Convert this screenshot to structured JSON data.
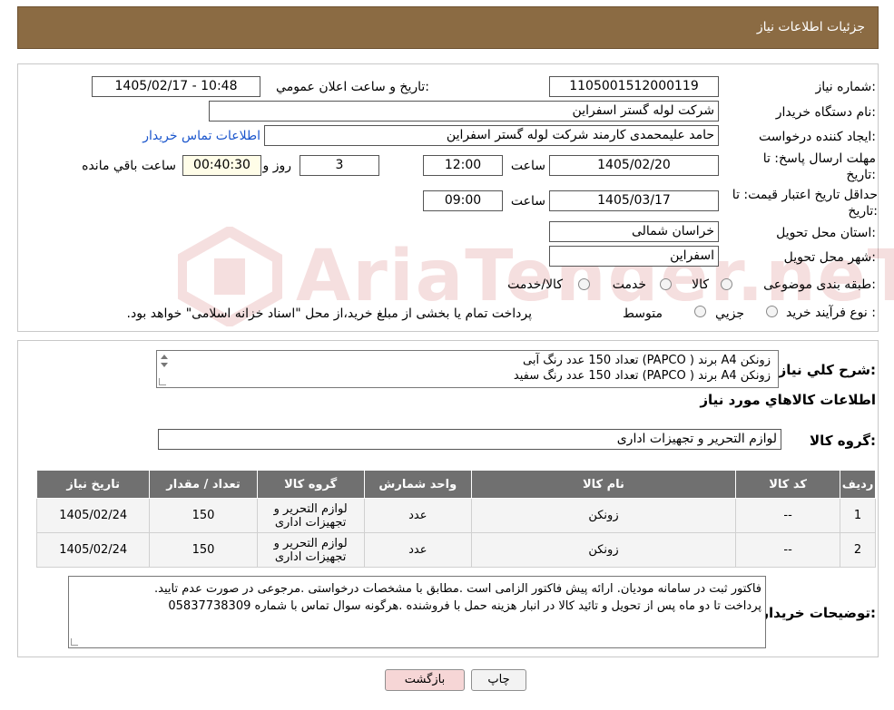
{
  "header": {
    "title": "جزئیات اطلاعات نیاز"
  },
  "form": {
    "need_number_label": "شماره نیاز:",
    "need_number": "1105001512000119",
    "announce_label": "تاریخ و ساعت اعلان عمومي:",
    "announce_value": "1405/02/17 - 10:48",
    "buyer_label": "نام دستگاه خريدار:",
    "buyer_value": "شرکت لوله گستر اسفراین",
    "creator_label": "ایجاد کننده درخواست:",
    "creator_value": "حامد علیمحمدی کارمند شرکت لوله گستر اسفراین",
    "contact_link": "اطلاعات تماس خریدار",
    "deadline_label": "مهلت ارسال پاسخ: تا تاریخ:",
    "deadline_date": "1405/02/20",
    "time_label": "ساعت",
    "deadline_time": "12:00",
    "days_value": "3",
    "days_label": "روز و",
    "remaining_value": "00:40:30",
    "remaining_label": "ساعت باقي مانده",
    "validity_label": "حداقل تاريخ اعتبار قيمت: تا تاریخ:",
    "validity_date": "1405/03/17",
    "validity_time_label": "ساعت",
    "validity_time": "09:00",
    "province_label": "استان محل تحویل:",
    "province_value": "خراسان شمالی",
    "city_label": "شهر محل تحویل:",
    "city_value": "اسفراین",
    "category_label": "طبقه بندی موضوعی:",
    "category_options": [
      "کالا",
      "خدمت",
      "کالا/خدمت"
    ],
    "process_label": "نوع فرآيند خريد :",
    "process_options": [
      "جزيي",
      "متوسط"
    ],
    "process_note": "پرداخت تمام يا بخشی از مبلغ خريد،از محل \"اسناد خزانه اسلامی\" خواهد بود."
  },
  "details": {
    "summary_label": "شرح کلي نياز:",
    "summary_lines": [
      "زونکن A4 برند ( PAPCO) تعداد 150 عدد رنگ آبی",
      "زونکن A4 برند ( PAPCO) تعداد 150 عدد رنگ سفید"
    ],
    "goods_info_title": "اطلاعات کالاهاي مورد نياز",
    "goods_group_label": "گروه کالا:",
    "goods_group_value": "لوازم التحرير و تجهيزات اداری"
  },
  "table": {
    "headers": [
      "رديف",
      "کد کالا",
      "نام کالا",
      "واحد شمارش",
      "گروه کالا",
      "تعداد / مقدار",
      "تاريخ نياز"
    ],
    "rows": [
      [
        "1",
        "--",
        "زونکن",
        "عدد",
        "لوازم التحرير و تجهيزات اداری",
        "150",
        "1405/02/24"
      ],
      [
        "2",
        "--",
        "زونکن",
        "عدد",
        "لوازم التحرير و تجهيزات اداری",
        "150",
        "1405/02/24"
      ]
    ]
  },
  "notes": {
    "label": "توضیحات خریدار:",
    "lines": [
      "فاکتور ثبت در سامانه مودیان. ارائه پیش فاکتور الزامی است .مطابق با مشخصات درخواستی .مرجوعی در صورت عدم تایید.",
      "پرداخت تا دو ماه پس از تحویل و تائید کالا در انبار  هزینه حمل با فروشنده .هرگونه سوال تماس با شماره 05837738309"
    ]
  },
  "buttons": {
    "print": "چاپ",
    "back": "بازگشت"
  },
  "watermark": "AriaTender.neT"
}
